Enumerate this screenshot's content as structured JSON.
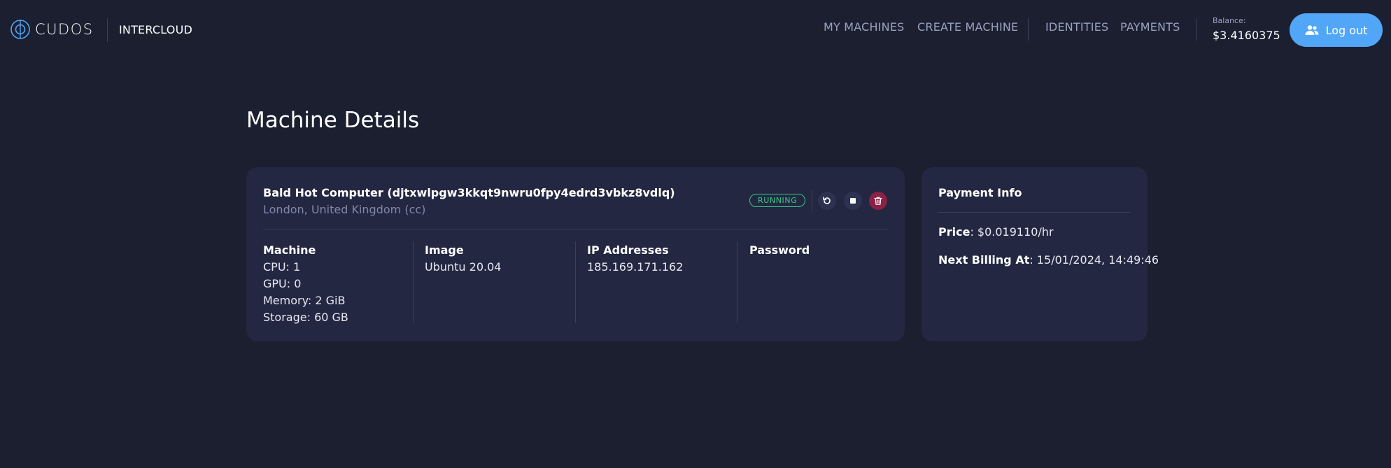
{
  "header": {
    "brand": "CUDOS",
    "product": "INTERCLOUD",
    "nav": {
      "my_machines": "MY MACHINES",
      "create_machine": "CREATE MACHINE",
      "identities": "IDENTITIES",
      "payments": "PAYMENTS"
    },
    "balance_label": "Balance:",
    "balance_value": "$3.4160375",
    "logout_label": "Log out"
  },
  "page": {
    "title": "Machine Details"
  },
  "machine": {
    "name": "Bald Hot Computer (djtxwlpgw3kkqt9nwru0fpy4edrd3vbkz8vdlq)",
    "location": "London, United Kingdom (cc)",
    "status": "RUNNING",
    "specs": {
      "heading": "Machine",
      "cpu": "CPU: 1",
      "gpu": "GPU: 0",
      "memory": "Memory: 2 GiB",
      "storage": "Storage: 60 GB"
    },
    "image": {
      "heading": "Image",
      "value": "Ubuntu 20.04"
    },
    "ip": {
      "heading": "IP Addresses",
      "value": "185.169.171.162"
    },
    "password": {
      "heading": "Password"
    }
  },
  "payment": {
    "title": "Payment Info",
    "price_label": "Price",
    "price_value": ": $0.019110/hr",
    "billing_label": "Next Billing At",
    "billing_value": ": 15/01/2024, 14:49:46"
  },
  "colors": {
    "background": "#1b1f30",
    "card": "#232741",
    "accent": "#52a6f8",
    "running": "#37c98a",
    "delete": "#8b2145"
  },
  "icons": {
    "logo": "cudos-logo-icon",
    "logout": "users-icon",
    "restart": "restart-icon",
    "stop": "stop-icon",
    "delete": "trash-icon"
  }
}
